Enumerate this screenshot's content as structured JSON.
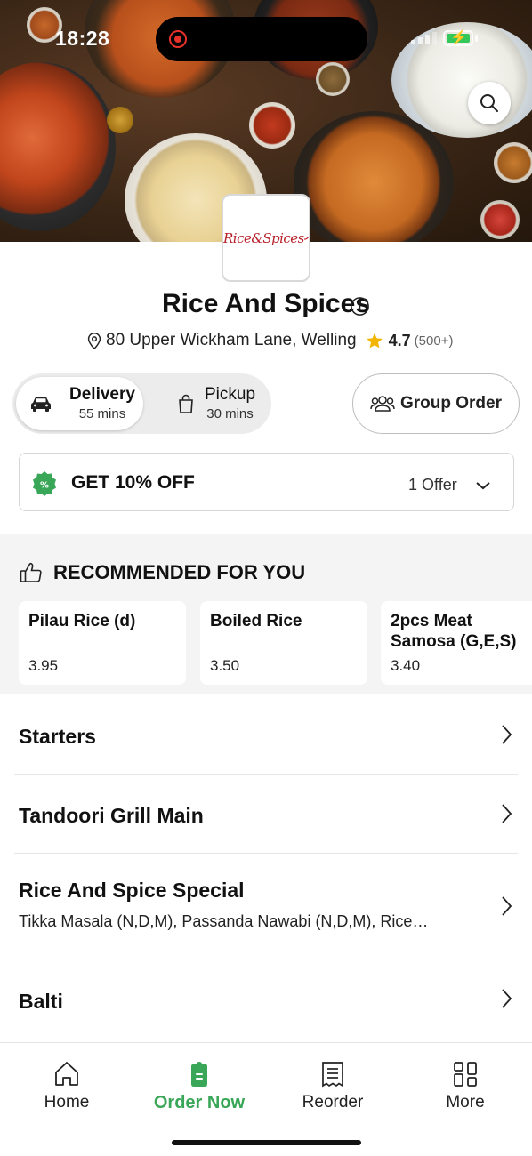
{
  "status_bar": {
    "time": "18:28"
  },
  "restaurant": {
    "logo_text": "Rice&Spices",
    "name": "Rice And Spices",
    "address": "80 Upper Wickham Lane, Welling",
    "rating": "4.7",
    "rating_count": "(500+)"
  },
  "order_mode": {
    "delivery": {
      "label": "Delivery",
      "time": "55 mins",
      "selected": true
    },
    "pickup": {
      "label": "Pickup",
      "time": "30 mins",
      "selected": false
    }
  },
  "group_order": {
    "label": "Group Order"
  },
  "offer": {
    "title": "GET 10% OFF",
    "count": "1 Offer"
  },
  "recommended": {
    "title": "RECOMMENDED FOR YOU",
    "items": [
      {
        "name": "Pilau Rice (d)",
        "price": "3.95"
      },
      {
        "name": "Boiled Rice",
        "price": "3.50"
      },
      {
        "name": "2pcs Meat Samosa (G,E,S)",
        "price": "3.40"
      }
    ]
  },
  "menu": [
    {
      "title": "Starters",
      "desc": ""
    },
    {
      "title": "Tandoori Grill Main",
      "desc": ""
    },
    {
      "title": "Rice And Spice Special",
      "desc": "Tikka Masala (N,D,M), Passanda Nawabi (N,D,M), Rice…"
    },
    {
      "title": "Balti",
      "desc": ""
    }
  ],
  "bottom_nav": [
    {
      "label": "Home",
      "icon": "home-icon",
      "active": false
    },
    {
      "label": "Order Now",
      "icon": "order-bag-icon",
      "active": true
    },
    {
      "label": "Reorder",
      "icon": "receipt-icon",
      "active": false
    },
    {
      "label": "More",
      "icon": "grid-icon",
      "active": false
    }
  ],
  "colors": {
    "accent_green": "#3aa657",
    "star": "#f2b500",
    "offer_badge": "#3aa657"
  }
}
